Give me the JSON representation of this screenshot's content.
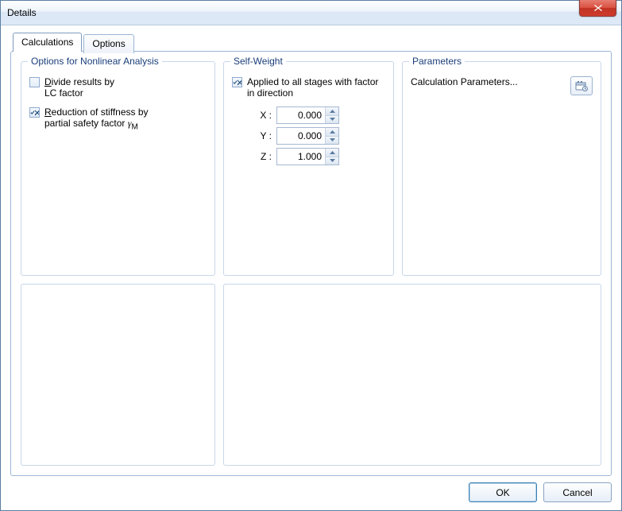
{
  "window": {
    "title": "Details"
  },
  "tabs": {
    "calculations": "Calculations",
    "options": "Options"
  },
  "groups": {
    "nonlinear": {
      "legend": "Options for Nonlinear Analysis",
      "divide_pre": "D",
      "divide_mid": "ivide results by",
      "divide_sub": "LC factor",
      "reduction_pre": "R",
      "reduction_mid": "eduction of stiffness by",
      "reduction_sub_a": "partial safety factor ",
      "reduction_sub_b": "γ",
      "reduction_sub_c": "M"
    },
    "selfweight": {
      "legend": "Self-Weight",
      "applied_a": "Applied to all stages with factor",
      "applied_b": "in direction",
      "x_label": "X :",
      "y_label": "Y :",
      "z_label": "Z :",
      "x_value": "0.000",
      "y_value": "0.000",
      "z_value": "1.000"
    },
    "parameters": {
      "legend": "Parameters",
      "calc_params": "Calculation Parameters..."
    }
  },
  "buttons": {
    "ok": "OK",
    "cancel": "Cancel"
  }
}
